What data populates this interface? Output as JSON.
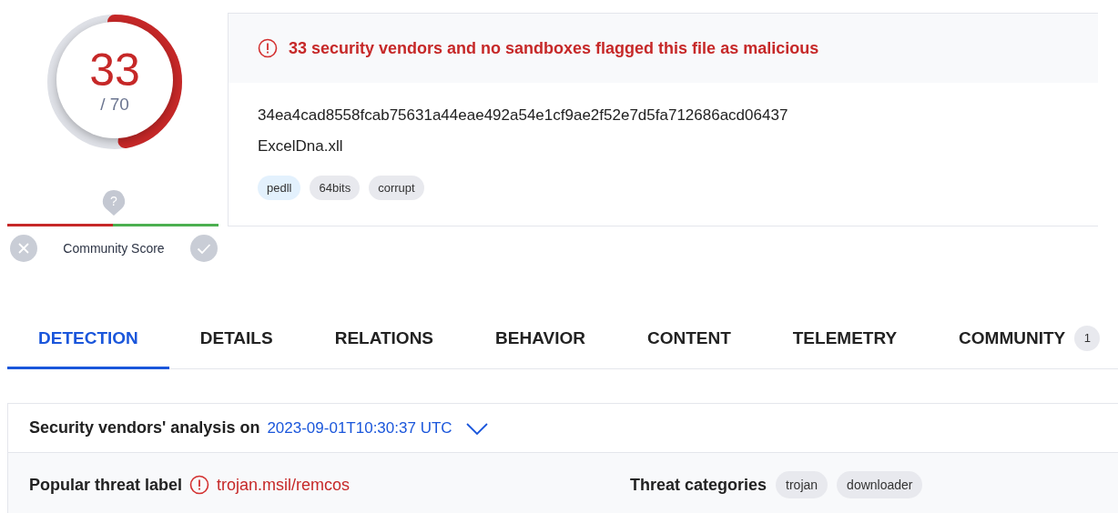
{
  "score": {
    "detections": "33",
    "total": "/ 70"
  },
  "community": {
    "icon": "?",
    "label": "Community Score"
  },
  "file": {
    "alert": "33 security vendors and no sandboxes flagged this file as malicious",
    "hash": "34ea4cad8558fcab75631a44eae492a54e1cf9ae2f52e7d5fa712686acd06437",
    "name": "ExcelDna.xll",
    "tags": [
      {
        "label": "pedll",
        "color": "#e3f1fd"
      },
      {
        "label": "64bits",
        "color": "#e8e9ee"
      },
      {
        "label": "corrupt",
        "color": "#e8e9ee"
      }
    ]
  },
  "tabs": [
    {
      "label": "DETECTION",
      "selected": true
    },
    {
      "label": "DETAILS",
      "selected": false
    },
    {
      "label": "RELATIONS",
      "selected": false
    },
    {
      "label": "BEHAVIOR",
      "selected": false
    },
    {
      "label": "CONTENT",
      "selected": false
    },
    {
      "label": "TELEMETRY",
      "selected": false
    },
    {
      "label": "COMMUNITY",
      "selected": false,
      "count": "1"
    }
  ],
  "analysis": {
    "heading": "Security vendors' analysis on",
    "date": "2023-09-01T10:30:37 UTC",
    "popular_label": "Popular threat label",
    "threat": "trojan.msil/remcos",
    "categories_label": "Threat categories",
    "categories": [
      "trojan",
      "downloader"
    ]
  }
}
